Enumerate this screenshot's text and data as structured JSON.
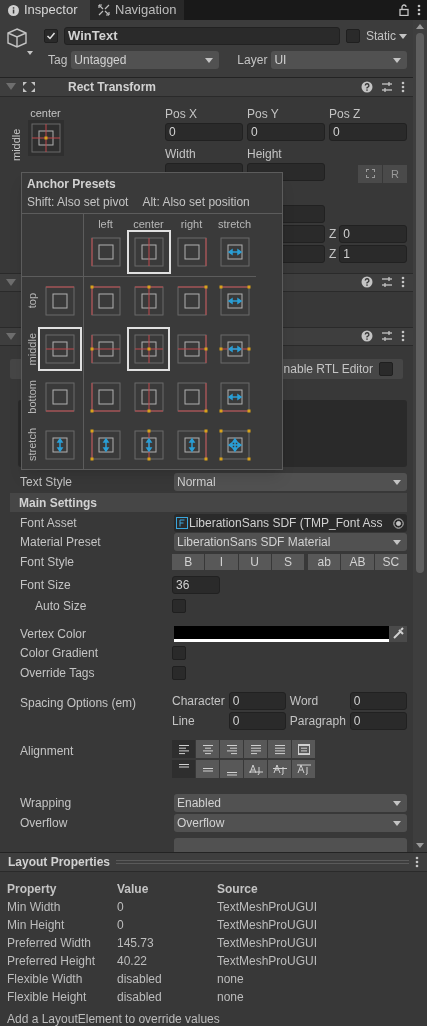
{
  "tabs": [
    {
      "label": "Inspector",
      "kind": "info",
      "selected": true
    },
    {
      "label": "Navigation",
      "kind": "nav",
      "selected": false
    }
  ],
  "object": {
    "active": true,
    "name": "WinText",
    "static_label": "Static",
    "static": false,
    "tag_label": "Tag",
    "tag": "Untagged",
    "layer_label": "Layer",
    "layer": "UI"
  },
  "rect_transform": {
    "title": "Rect Transform",
    "expanded": true,
    "anchor_h_label": "center",
    "anchor_v_label": "middle",
    "pos_labels": [
      "Pos X",
      "Pos Y",
      "Pos Z"
    ],
    "pos_values": [
      "0",
      "0",
      "0"
    ],
    "size_labels": [
      "Width",
      "Height"
    ],
    "button_label": "R",
    "z_rows": [
      {
        "label": "Z",
        "value": "0"
      },
      {
        "label": "Z",
        "value": "1"
      }
    ]
  },
  "component_headers": [
    {
      "expanded": true
    },
    {
      "expanded": true
    }
  ],
  "anchor_presets": {
    "title": "Anchor Presets",
    "hint_shift": "Shift: Also set pivot",
    "hint_alt": "Alt: Also set position",
    "columns": [
      {
        "label": "left",
        "kind": "left",
        "selected": false
      },
      {
        "label": "center",
        "kind": "center",
        "selected": true
      },
      {
        "label": "right",
        "kind": "right",
        "selected": false
      },
      {
        "label": "stretch",
        "kind": "stretch",
        "selected": false
      }
    ],
    "rows": [
      {
        "label": "top",
        "kind": "top",
        "selected": false,
        "cells": [
          {
            "selected": false
          },
          {
            "selected": false
          },
          {
            "selected": false
          },
          {
            "selected": false
          }
        ]
      },
      {
        "label": "middle",
        "kind": "middle",
        "selected": true,
        "cells": [
          {
            "selected": false
          },
          {
            "selected": true
          },
          {
            "selected": false
          },
          {
            "selected": false
          }
        ]
      },
      {
        "label": "bottom",
        "kind": "bottom",
        "selected": false,
        "cells": [
          {
            "selected": false
          },
          {
            "selected": false
          },
          {
            "selected": false
          },
          {
            "selected": false
          }
        ]
      },
      {
        "label": "stretch",
        "kind": "stretch",
        "selected": false,
        "cells": [
          {
            "selected": false
          },
          {
            "selected": false
          },
          {
            "selected": false
          },
          {
            "selected": false
          }
        ]
      }
    ]
  },
  "rtl": {
    "label": "nable RTL Editor",
    "checked": false
  },
  "text_style": {
    "label": "Text Style",
    "value": "Normal"
  },
  "main_settings": {
    "title": "Main Settings"
  },
  "font_asset": {
    "label": "Font Asset",
    "value": "LiberationSans SDF (TMP_Font Ass"
  },
  "material_preset": {
    "label": "Material Preset",
    "value": "LiberationSans SDF Material"
  },
  "font_style": {
    "label": "Font Style",
    "buttons": [
      {
        "label": "B",
        "on": false
      },
      {
        "label": "I",
        "on": false
      },
      {
        "label": "U",
        "on": false
      },
      {
        "label": "S",
        "on": false
      },
      {
        "label": "ab",
        "on": false
      },
      {
        "label": "AB",
        "on": false
      },
      {
        "label": "SC",
        "on": false
      }
    ]
  },
  "font_size": {
    "label": "Font Size",
    "value": "36"
  },
  "checks_a": [
    {
      "label": "Auto Size",
      "checked": false
    }
  ],
  "vertex_color": {
    "label": "Vertex Color"
  },
  "checks_b": [
    {
      "label": "Color Gradient",
      "checked": false
    },
    {
      "label": "Override Tags",
      "checked": false
    }
  ],
  "spacing": {
    "label": "Spacing Options (em)",
    "fields": [
      {
        "label": "Character",
        "value": "0"
      },
      {
        "label": "Word",
        "value": "0"
      },
      {
        "label": "Line",
        "value": "0"
      },
      {
        "label": "Paragraph",
        "value": "0"
      }
    ]
  },
  "alignment": {
    "label": "Alignment",
    "horizontal": [
      {
        "kind": "left",
        "selected": true
      },
      {
        "kind": "center",
        "selected": false
      },
      {
        "kind": "right",
        "selected": false
      },
      {
        "kind": "justified",
        "selected": false
      },
      {
        "kind": "flush",
        "selected": false
      },
      {
        "kind": "geometry",
        "selected": false
      }
    ],
    "vertical": [
      {
        "kind": "top",
        "selected": true
      },
      {
        "kind": "middle",
        "selected": false
      },
      {
        "kind": "bottom",
        "selected": false
      },
      {
        "kind": "baseline",
        "selected": false
      },
      {
        "kind": "midline",
        "selected": false
      },
      {
        "kind": "capline",
        "selected": false
      }
    ]
  },
  "dropdowns": [
    {
      "label": "Wrapping",
      "value": "Enabled"
    },
    {
      "label": "Overflow",
      "value": "Overflow"
    }
  ],
  "layout_properties": {
    "title": "Layout Properties",
    "columns": [
      "Property",
      "Value",
      "Source"
    ],
    "rows": [
      [
        "Min Width",
        "0",
        "TextMeshProUGUI"
      ],
      [
        "Min Height",
        "0",
        "TextMeshProUGUI"
      ],
      [
        "Preferred Width",
        "145.73",
        "TextMeshProUGUI"
      ],
      [
        "Preferred Height",
        "40.22",
        "TextMeshProUGUI"
      ],
      [
        "Flexible Width",
        "disabled",
        "none"
      ],
      [
        "Flexible Height",
        "disabled",
        "none"
      ]
    ],
    "footer": "Add a LayoutElement to override values"
  }
}
